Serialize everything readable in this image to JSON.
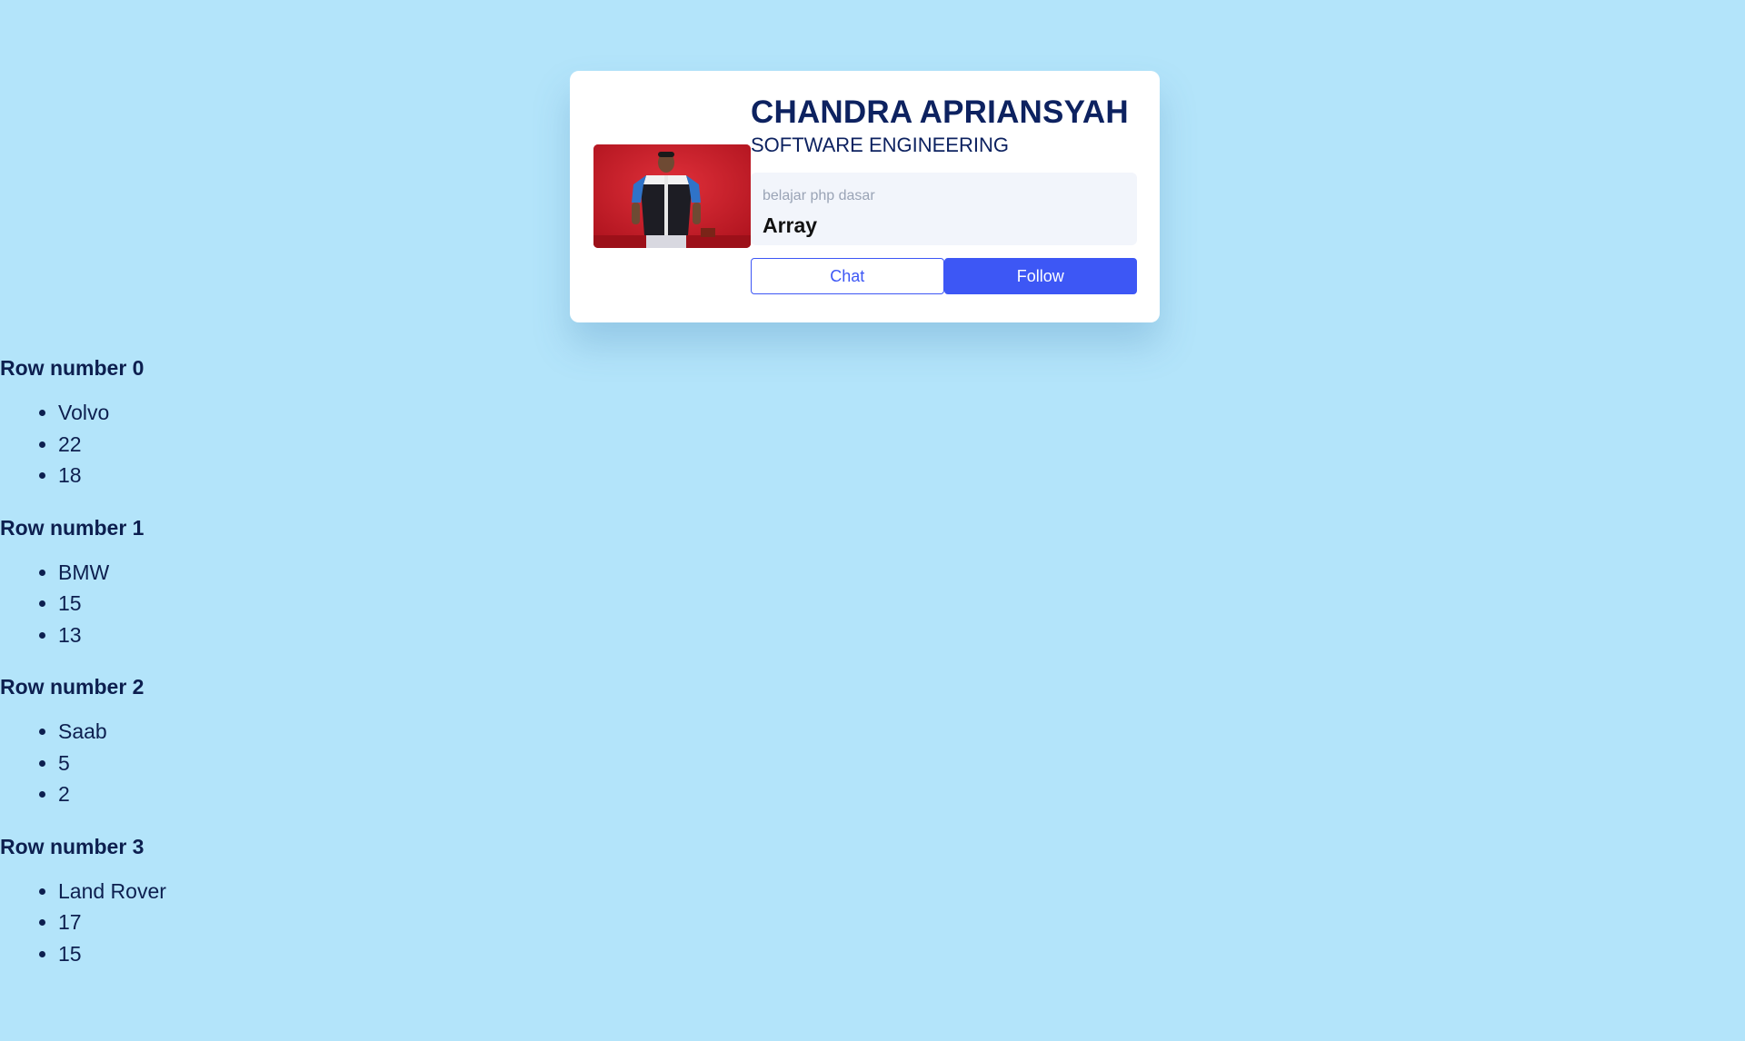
{
  "profile": {
    "name": "CHANDRA APRIANSYAH",
    "role": "SOFTWARE ENGINEERING",
    "photo_alt": "profile-photo",
    "stat_label": "belajar php dasar",
    "stat_value": "Array",
    "chat_label": "Chat",
    "follow_label": "Follow"
  },
  "rows": [
    {
      "title": "Row number 0",
      "items": [
        "Volvo",
        "22",
        "18"
      ]
    },
    {
      "title": "Row number 1",
      "items": [
        "BMW",
        "15",
        "13"
      ]
    },
    {
      "title": "Row number 2",
      "items": [
        "Saab",
        "5",
        "2"
      ]
    },
    {
      "title": "Row number 3",
      "items": [
        "Land Rover",
        "17",
        "15"
      ]
    }
  ],
  "colors": {
    "page_background": "#b3e4fa",
    "card_background": "#ffffff",
    "primary": "#3d57f5",
    "heading_text": "#0d2260",
    "muted_text": "#9aa4b6",
    "photo_background": "#c81d2a"
  }
}
